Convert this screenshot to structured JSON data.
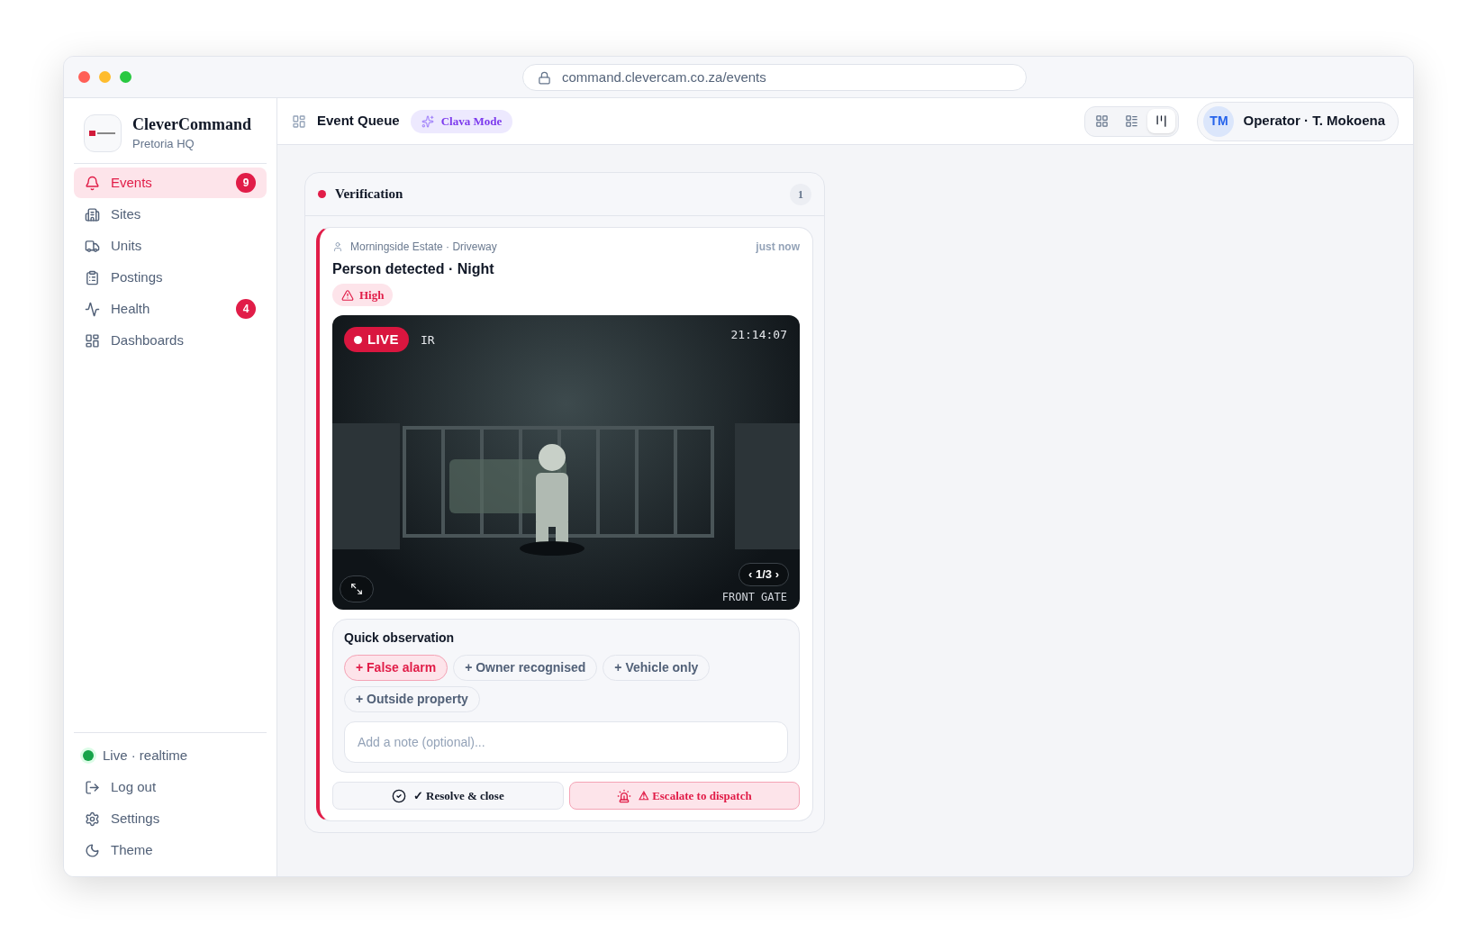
{
  "browser": {
    "url": "command.clevercam.co.za/events"
  },
  "brand": {
    "name": "CleverCommand",
    "subtitle": "Pretoria HQ"
  },
  "nav": [
    {
      "label": "Events",
      "badge": "9",
      "selected": true
    },
    {
      "label": "Sites",
      "selected": false
    },
    {
      "label": "Units",
      "selected": false
    },
    {
      "label": "Postings",
      "selected": false
    },
    {
      "label": "Health",
      "badge": "4",
      "selected": false
    },
    {
      "label": "Dashboards",
      "selected": false
    }
  ],
  "status": {
    "label": "Live · realtime",
    "color": "#16a34a"
  },
  "footer_nav": [
    {
      "label": "Log out"
    },
    {
      "label": "Settings"
    },
    {
      "label": "Theme"
    }
  ],
  "topbar": {
    "title": "Event Queue",
    "mode_badge": "Clava Mode",
    "views": [
      {
        "selected": false
      },
      {
        "selected": false
      },
      {
        "selected": true
      }
    ],
    "user": {
      "initials": "TM",
      "label": "Operator · T. Mokoena"
    }
  },
  "column": {
    "title": "Verification",
    "count": "1"
  },
  "event": {
    "location": "Morningside Estate · Driveway",
    "time": "just now",
    "title": "Person detected · Night",
    "severity": "High",
    "video": {
      "live": "LIVE",
      "overlay": "IR",
      "timestamp": "21:14:07",
      "pager": "‹ 1/3 ›",
      "camera": "FRONT GATE"
    },
    "observation": {
      "title": "Quick observation",
      "chips": [
        {
          "label": "+ False alarm",
          "selected": true
        },
        {
          "label": "+ Owner recognised",
          "selected": false
        },
        {
          "label": "+ Vehicle only",
          "selected": false
        },
        {
          "label": "+ Outside property",
          "selected": false
        }
      ],
      "note_placeholder": "Add a note (optional)..."
    },
    "actions": [
      {
        "kind": "resolve",
        "label": "✓ Resolve & close"
      },
      {
        "kind": "escalate",
        "label": "⚠ Escalate to dispatch"
      }
    ]
  }
}
